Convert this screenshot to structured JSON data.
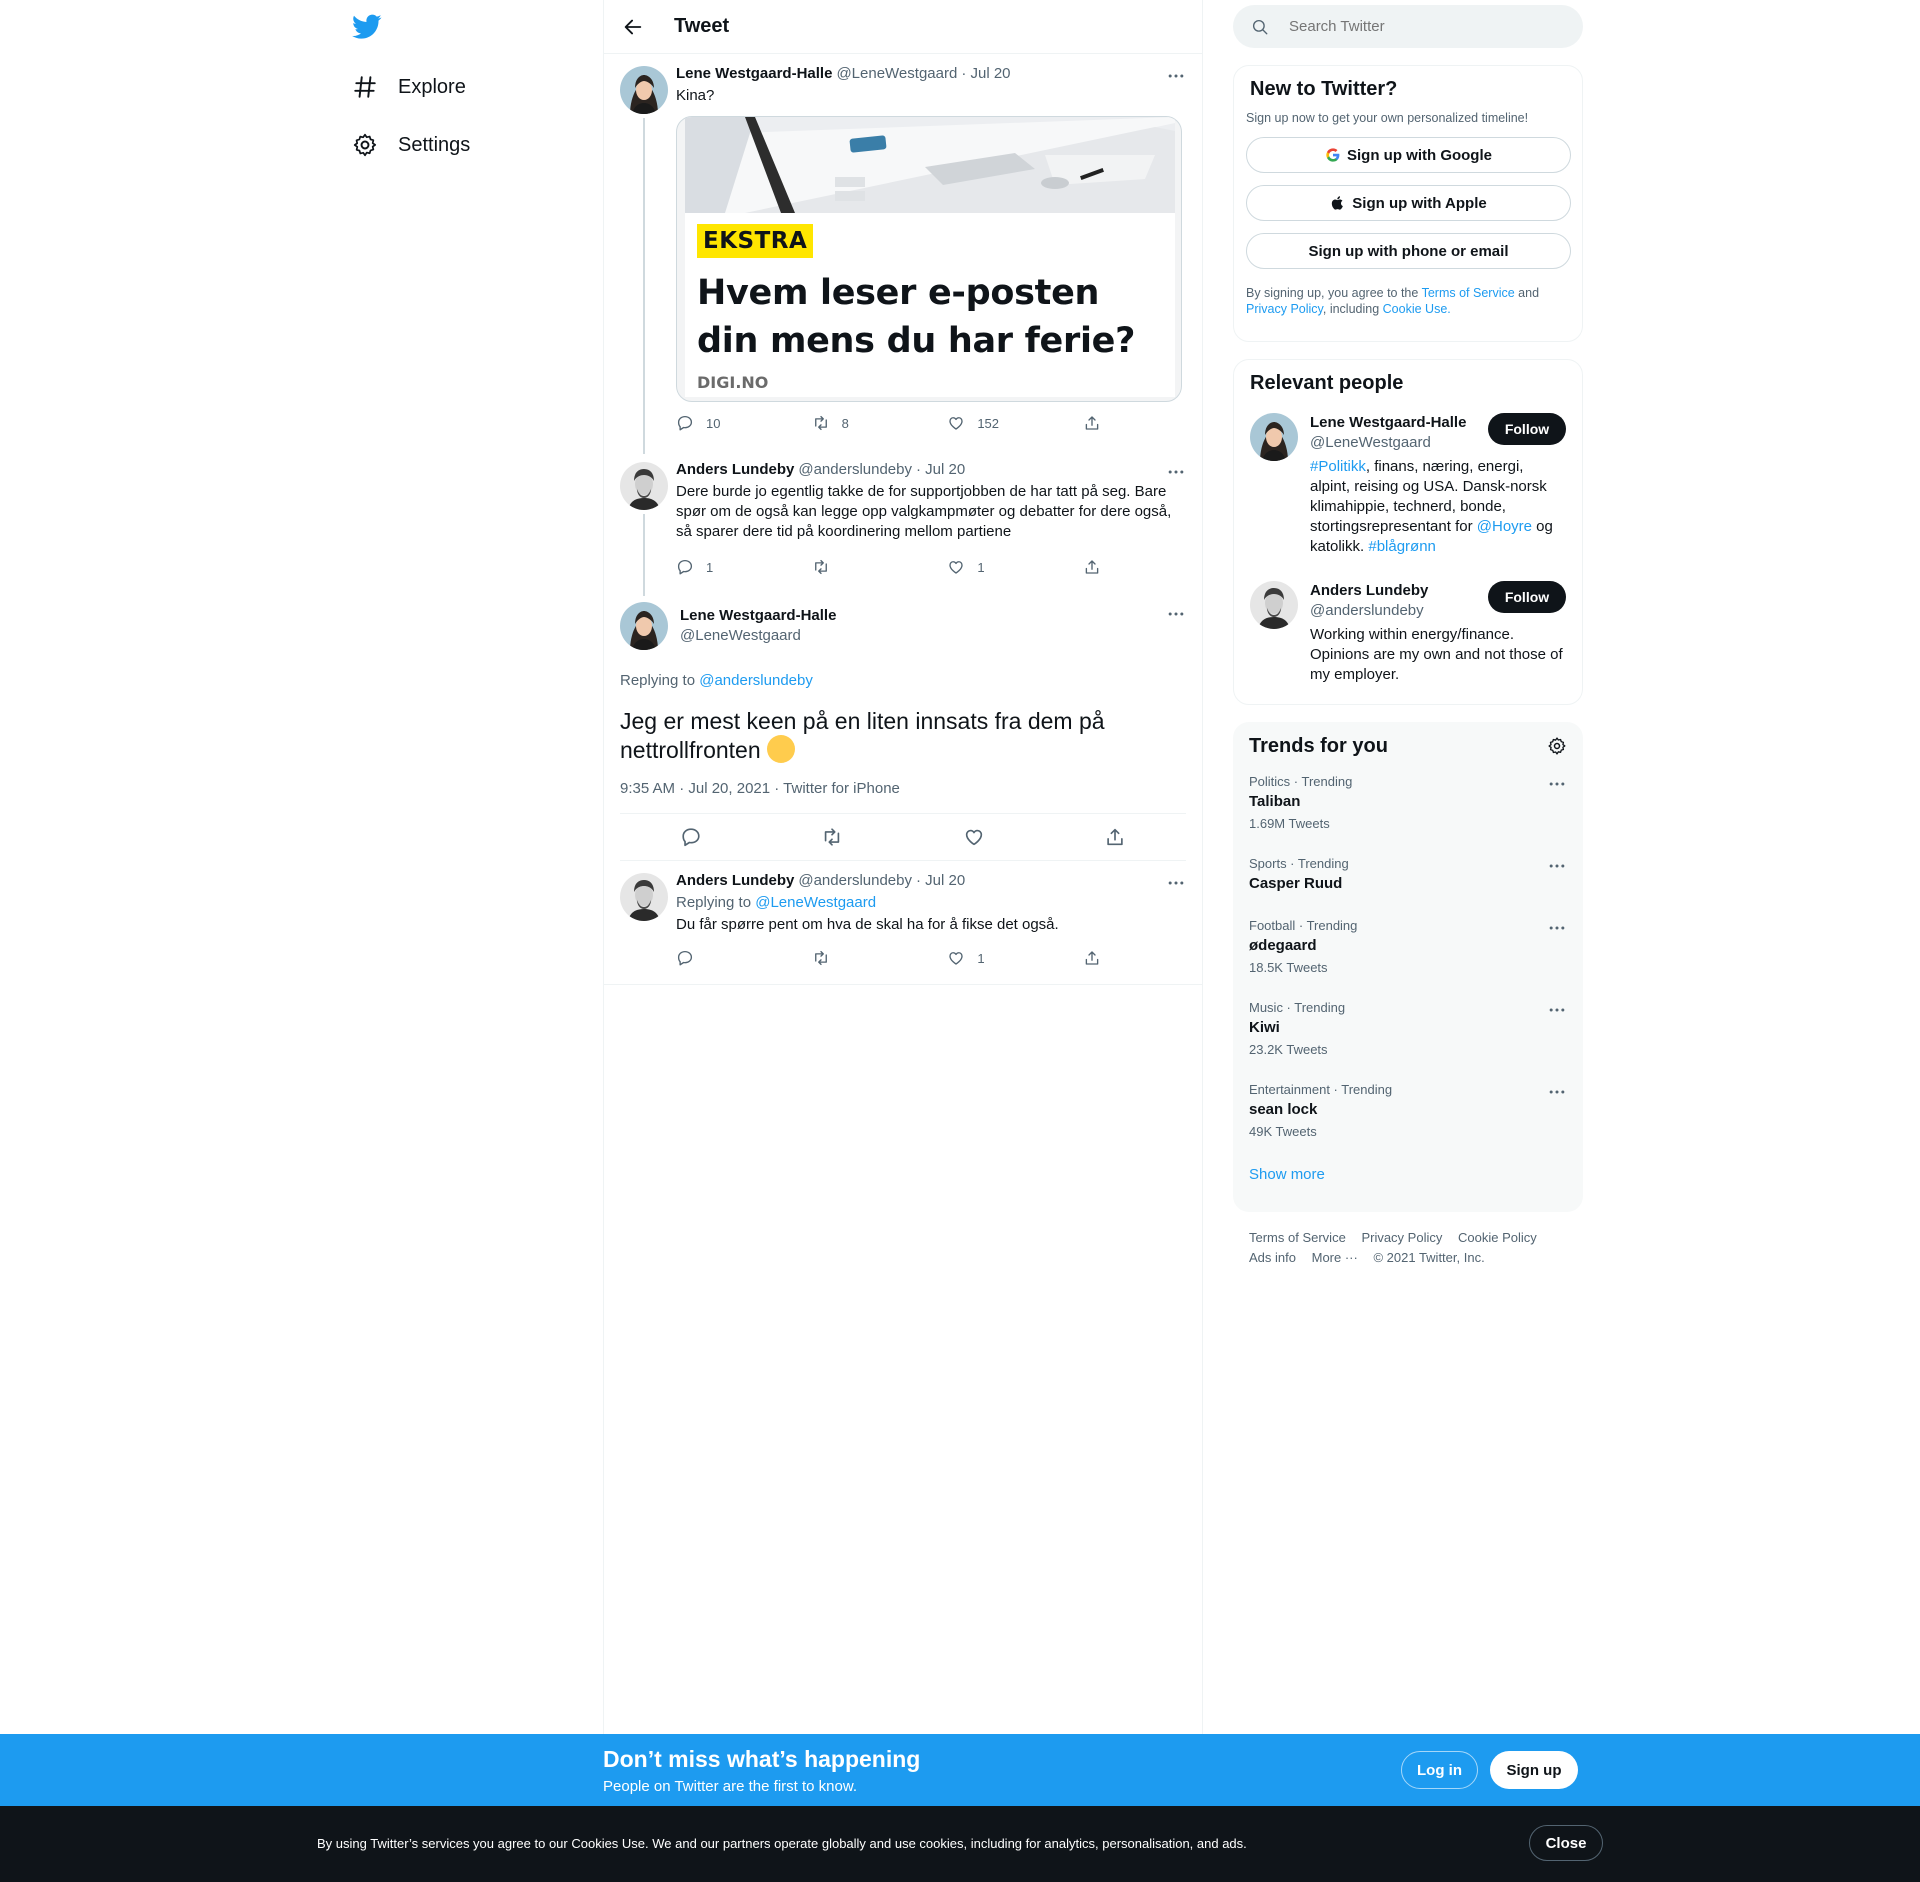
{
  "nav": {
    "explore": "Explore",
    "settings": "Settings"
  },
  "header": {
    "title": "Tweet"
  },
  "colors": {
    "accent": "#1d9bf0",
    "text": "#0f1419",
    "muted": "#536471",
    "badge": "#ffe600"
  },
  "tweets": [
    {
      "name": "Lene Westgaard-Halle",
      "handle": "@LeneWestgaard",
      "date": "· Jul 20",
      "text": "Kina?",
      "card": {
        "badge": "EKSTRA",
        "title": "Hvem leser e-posten din mens du har ferie?",
        "source": "DIGI.NO"
      },
      "replies": "10",
      "retweets": "8",
      "likes": "152"
    },
    {
      "name": "Anders Lundeby",
      "handle": "@anderslundeby",
      "date": "· Jul 20",
      "text": "Dere burde jo egentlig takke de for supportjobben de har tatt på seg. Bare spør om de også kan legge opp valgkampmøter og debatter for dere også, så sparer dere tid på koordinering mellom partiene",
      "replies": "1",
      "retweets": "",
      "likes": "1"
    }
  ],
  "focal": {
    "name": "Lene Westgaard-Halle",
    "handle": "@LeneWestgaard",
    "replying_label": "Replying to",
    "replying_to": "@anderslundeby",
    "text": "Jeg er mest keen på en liten innsats fra dem på nettrollfronten",
    "emoji": "😄",
    "meta": "9:35 AM · Jul 20, 2021 · Twitter for iPhone"
  },
  "reply": {
    "name": "Anders Lundeby",
    "handle": "@anderslundeby",
    "date": "· Jul 20",
    "replying_label": "Replying to",
    "replying_to": "@LeneWestgaard",
    "text": "Du får spørre pent om hva de skal ha for å fikse det også.",
    "replies": "",
    "retweets": "",
    "likes": "1"
  },
  "search": {
    "placeholder": "Search Twitter"
  },
  "new_to_twitter": {
    "title": "New to Twitter?",
    "subtitle": "Sign up now to get your own personalized timeline!",
    "google": "Sign up with Google",
    "apple": "Sign up with Apple",
    "phone": "Sign up with phone or email",
    "legal_1": "By signing up, you agree to the",
    "terms": "Terms of Service",
    "legal_2": "and",
    "privacy": "Privacy Policy",
    "legal_3": ", including",
    "cookie": "Cookie Use."
  },
  "relevant_people": {
    "title": "Relevant people",
    "follow": "Follow",
    "people": [
      {
        "name": "Lene Westgaard-Halle",
        "handle": "@LeneWestgaard",
        "bio_tag1": "#Politikk",
        "bio_1": ", finans, næring, energi, alpint, reising og USA. Dansk-norsk klimahippie, technerd, bonde, stortingsrepresentant for",
        "bio_tag2": "@Hoyre",
        "bio_2": " og katolikk.",
        "bio_tag3": "#blågrønn"
      },
      {
        "name": "Anders Lundeby",
        "handle": "@anderslundeby",
        "bio": "Working within energy/finance. Opinions are my own and not those of my employer."
      }
    ]
  },
  "trends": {
    "title": "Trends for you",
    "items": [
      {
        "context": "Politics · Trending",
        "name": "Taliban",
        "count": "1.69M Tweets"
      },
      {
        "context": "Sports · Trending",
        "name": "Casper Ruud",
        "count": ""
      },
      {
        "context": "Football · Trending",
        "name": "ødegaard",
        "count": "18.5K Tweets"
      },
      {
        "context": "Music · Trending",
        "name": "Kiwi",
        "count": "23.2K Tweets"
      },
      {
        "context": "Entertainment · Trending",
        "name": "sean lock",
        "count": "49K Tweets"
      }
    ],
    "show_more": "Show more"
  },
  "footer": {
    "terms": "Terms of Service",
    "privacy": "Privacy Policy",
    "cookie": "Cookie Policy",
    "ads": "Ads info",
    "more": "More ···",
    "copyright": "© 2021 Twitter, Inc."
  },
  "bottom_bar": {
    "title": "Don’t miss what’s happening",
    "subtitle": "People on Twitter are the first to know.",
    "login": "Log in",
    "signup": "Sign up"
  },
  "cookie_bar": {
    "text": "By using Twitter’s services you agree to our Cookies Use. We and our partners operate globally and use cookies, including for analytics, personalisation, and ads.",
    "close": "Close"
  }
}
